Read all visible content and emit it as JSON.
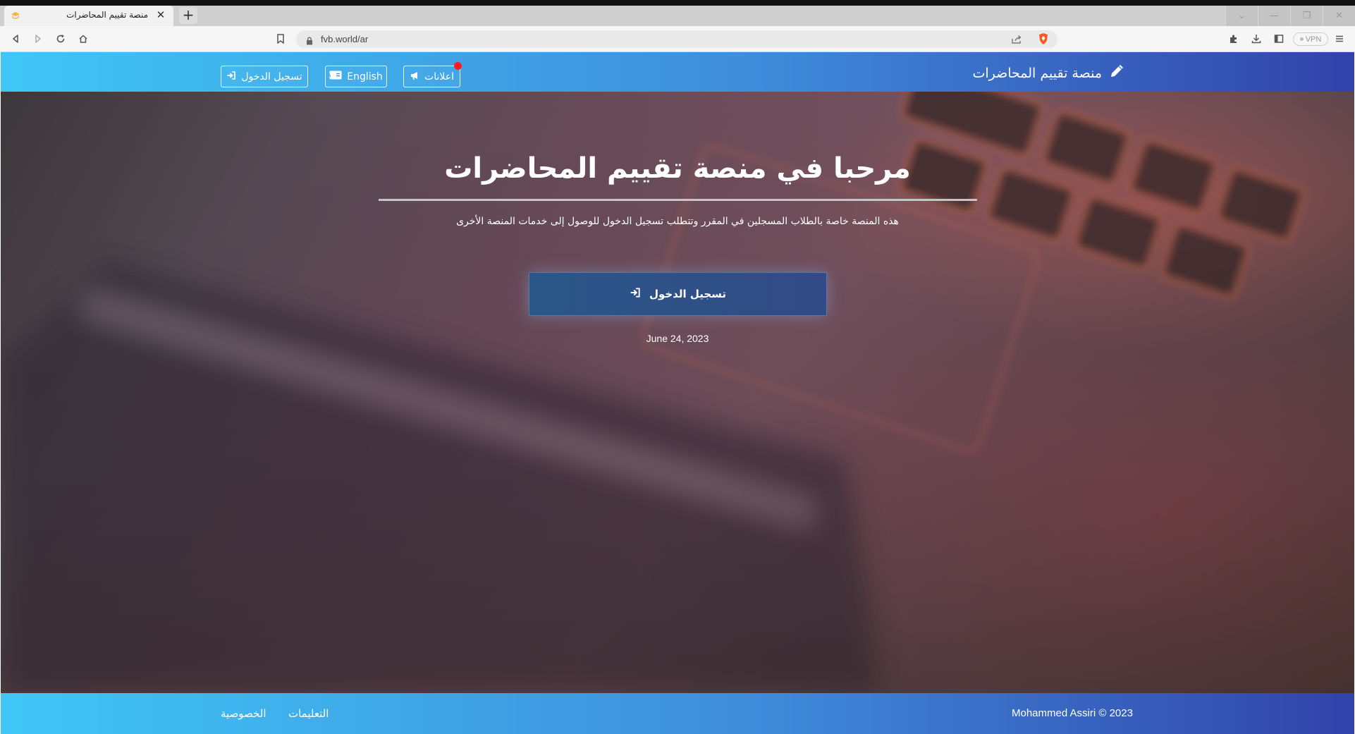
{
  "browser": {
    "tab_title": "منصة تقييم المحاضرات",
    "tab_close": "✕",
    "new_tab": "+",
    "url": "fvb.world/ar",
    "vpn_label": "VPN",
    "window_controls": {
      "dropdown": "⌄",
      "minimize": "—",
      "restore": "❐",
      "close": "✕"
    }
  },
  "navbar": {
    "brand": "منصة تقييم المحاضرات",
    "announcements_label": "اعلانات",
    "english_label": "English",
    "login_label": "تسجيل الدخول"
  },
  "hero": {
    "title": "مرحبا في منصة تقييم المحاضرات",
    "subtitle": "هذه المنصة خاصة بالطلاب المسجلين في المقرر وتتطلب تسجيل الدخول للوصول إلى خدمات المنصة الأخرى",
    "login_button": "تسجيل الدخول",
    "date": "June 24, 2023"
  },
  "footer": {
    "copyright": "Mohammed Assiri © 2023",
    "instructions": "التعليمات",
    "privacy": "الخصوصية"
  },
  "colors": {
    "nav_gradient_start": "#3fc6f6",
    "nav_gradient_end": "#3242aa",
    "login_button": "#2a5788",
    "notification_dot": "#ff1d1d"
  }
}
